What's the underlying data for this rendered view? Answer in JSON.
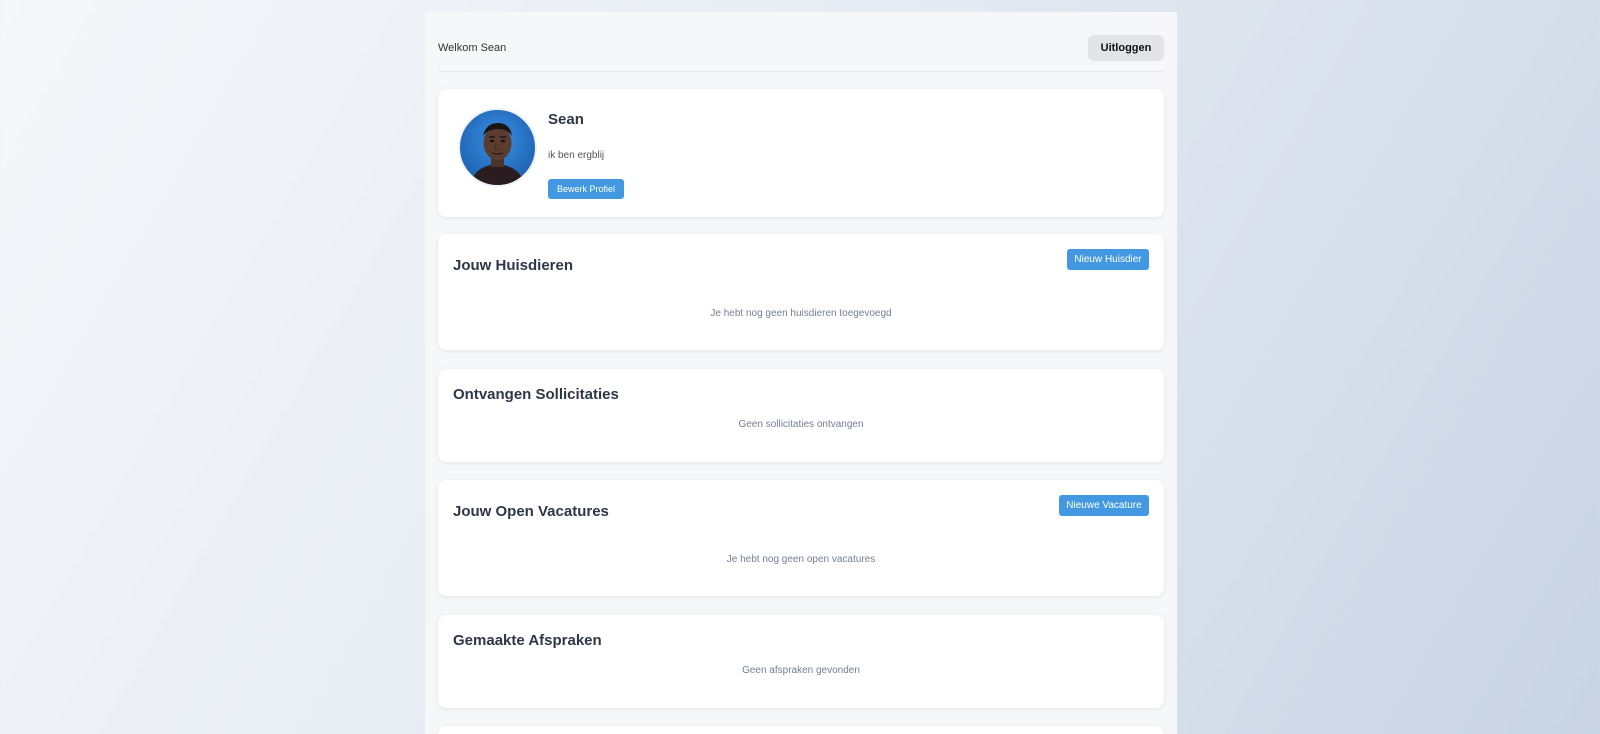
{
  "header": {
    "welcome": "Welkom Sean",
    "logout_label": "Uitloggen"
  },
  "profile": {
    "name": "Sean",
    "bio": "ik ben ergblij",
    "edit_label": "Bewerk Profiel"
  },
  "pets": {
    "title": "Jouw Huisdieren",
    "new_label": "Nieuw Huisdier",
    "empty": "Je hebt nog geen huisdieren toegevoegd"
  },
  "applications": {
    "title": "Ontvangen Sollicitaties",
    "empty": "Geen sollicitaties ontvangen"
  },
  "vacancies": {
    "title": "Jouw Open Vacatures",
    "new_label": "Nieuwe Vacature",
    "empty": "Je hebt nog geen open vacatures"
  },
  "appointments": {
    "title": "Gemaakte Afspraken",
    "empty": "Geen afspraken gevonden"
  },
  "colors": {
    "accent": "#4299e1",
    "heading": "#2d3748",
    "muted": "#718096"
  }
}
